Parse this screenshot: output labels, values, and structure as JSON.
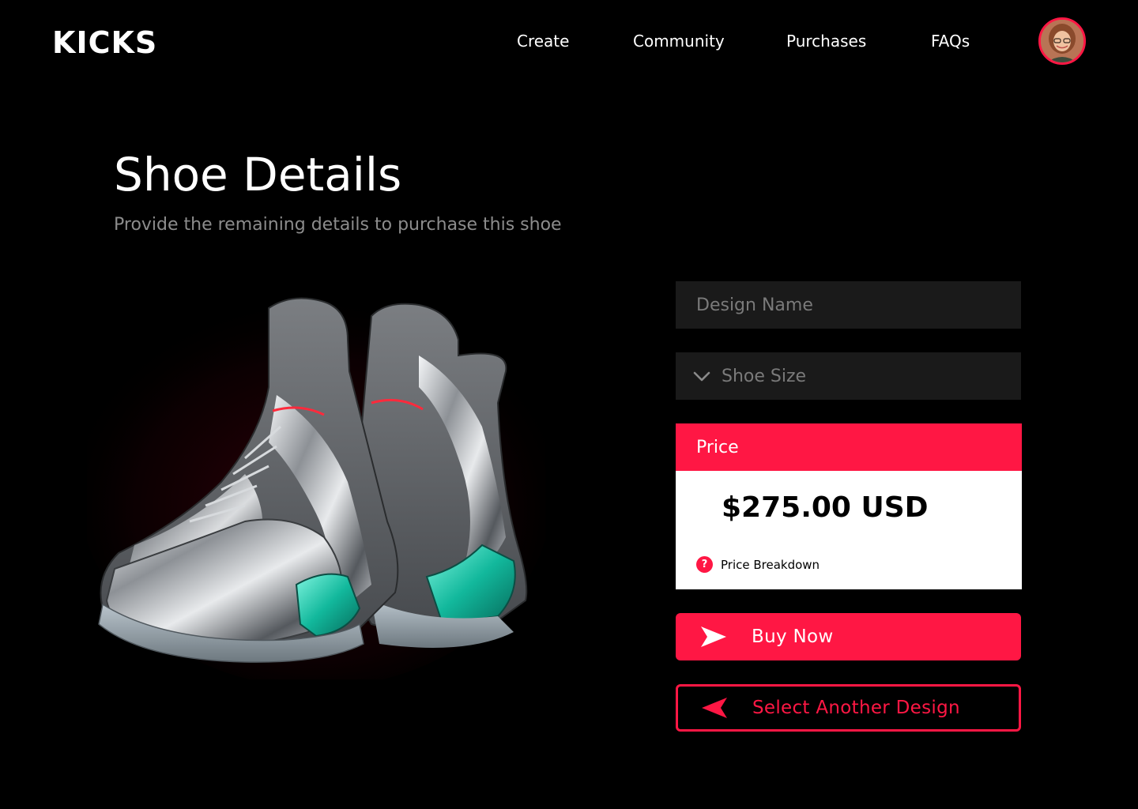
{
  "brand": {
    "logo": "KICKS"
  },
  "nav": {
    "items": [
      {
        "label": "Create"
      },
      {
        "label": "Community"
      },
      {
        "label": "Purchases"
      },
      {
        "label": "FAQs"
      }
    ]
  },
  "page": {
    "title": "Shoe Details",
    "subtitle": "Provide the remaining details to purchase this shoe"
  },
  "form": {
    "design_name": {
      "value": "",
      "placeholder": "Design Name"
    },
    "shoe_size": {
      "selected": "Shoe Size"
    }
  },
  "price": {
    "header": "Price",
    "value": "$275.00 USD",
    "breakdown_label": "Price Breakdown"
  },
  "actions": {
    "buy_now": "Buy Now",
    "select_another": "Select Another Design"
  },
  "colors": {
    "accent": "#ff1744",
    "background": "#000000",
    "field_bg": "#1a1a1a",
    "muted_text": "#8c8c8c"
  },
  "icons": {
    "shoe_size_dropdown": "chevron-down-icon",
    "price_help": "question-circle-icon",
    "buy_now": "send-arrow-icon",
    "select_another": "back-arrow-icon"
  }
}
